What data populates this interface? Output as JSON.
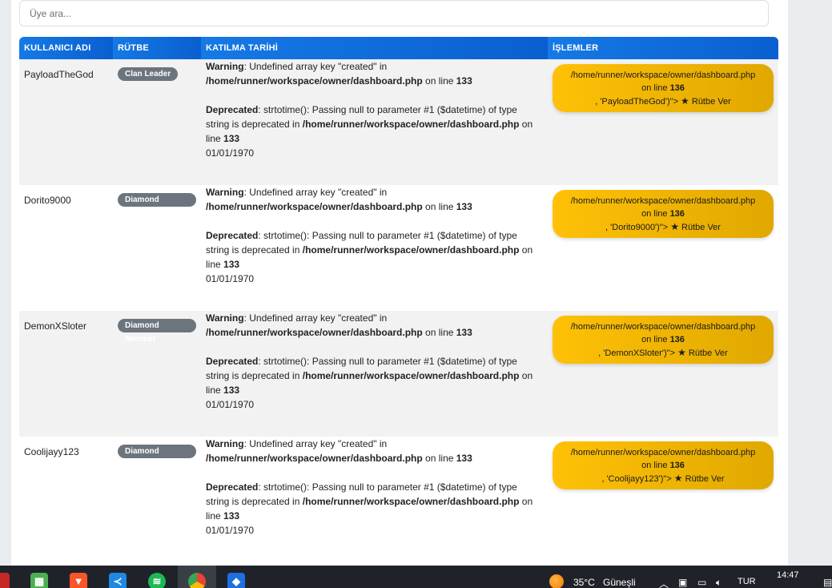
{
  "search": {
    "placeholder": "Üye ara..."
  },
  "table": {
    "headers": [
      "KULLANICI ADI",
      "RÜTBE",
      "KATILMA TARİHİ",
      "İŞLEMLER"
    ],
    "rows": [
      {
        "username": "PayloadTheGod",
        "rank": "Clan Leader",
        "warning": {
          "label": "Warning",
          "text": ": Undefined array key \"created\" in ",
          "path": "/home/runner/workspace/owner/dashboard.php",
          "online": " on line ",
          "line": "133"
        },
        "deprecated": {
          "label": "Deprecated",
          "text": ": strtotime(): Passing null to parameter #1 ($datetime) of type string is deprecated in ",
          "path": "/home/runner/workspace/owner/dashboard.php",
          "online": " on line ",
          "line": "133"
        },
        "date": "01/01/1970",
        "action": {
          "path": "/home/runner/workspace/owner/dashboard.php",
          "online": "on line ",
          "line": "136",
          "tail": ", 'PayloadTheGod')\"> ",
          "label": "Rütbe Ver"
        }
      },
      {
        "username": "Dorito9000",
        "rank": "Diamond Member",
        "warning": {
          "label": "Warning",
          "text": ": Undefined array key \"created\" in ",
          "path": "/home/runner/workspace/owner/dashboard.php",
          "online": " on line ",
          "line": "133"
        },
        "deprecated": {
          "label": "Deprecated",
          "text": ": strtotime(): Passing null to parameter #1 ($datetime) of type string is deprecated in ",
          "path": "/home/runner/workspace/owner/dashboard.php",
          "online": " on line ",
          "line": "133"
        },
        "date": "01/01/1970",
        "action": {
          "path": "/home/runner/workspace/owner/dashboard.php",
          "online": "on line ",
          "line": "136",
          "tail": ", 'Dorito9000')\"> ",
          "label": "Rütbe Ver"
        }
      },
      {
        "username": "DemonXSloter",
        "rank": "Diamond Member",
        "warning": {
          "label": "Warning",
          "text": ": Undefined array key \"created\" in ",
          "path": "/home/runner/workspace/owner/dashboard.php",
          "online": " on line ",
          "line": "133"
        },
        "deprecated": {
          "label": "Deprecated",
          "text": ": strtotime(): Passing null to parameter #1 ($datetime) of type string is deprecated in ",
          "path": "/home/runner/workspace/owner/dashboard.php",
          "online": " on line ",
          "line": "133"
        },
        "date": "01/01/1970",
        "action": {
          "path": "/home/runner/workspace/owner/dashboard.php",
          "online": "on line ",
          "line": "136",
          "tail": ", 'DemonXSloter')\"> ",
          "label": "Rütbe Ver"
        }
      },
      {
        "username": "Coolijayy123",
        "rank": "Diamond Member",
        "warning": {
          "label": "Warning",
          "text": ": Undefined array key \"created\" in ",
          "path": "/home/runner/workspace/owner/dashboard.php",
          "online": " on line ",
          "line": "133"
        },
        "deprecated": {
          "label": "Deprecated",
          "text": ": strtotime(): Passing null to parameter #1 ($datetime) of type string is deprecated in ",
          "path": "/home/runner/workspace/owner/dashboard.php",
          "online": " on line ",
          "line": "133"
        },
        "date": "01/01/1970",
        "action": {
          "path": "/home/runner/workspace/owner/dashboard.php",
          "online": "on line ",
          "line": "136",
          "tail": ", 'Coolijayy123')\"> ",
          "label": "Rütbe Ver"
        }
      }
    ]
  },
  "taskbar": {
    "apps": [
      "minecraft-icon",
      "brave-icon",
      "vscode-icon",
      "spotify-icon",
      "chrome-icon",
      "roblox-icon"
    ],
    "weather_temp": "35°C",
    "weather_text": "Güneşli",
    "lang": "TUR",
    "time": "14:47"
  },
  "colors": {
    "header": "#0a64d6",
    "badge": "#6c757d",
    "button": "#ffc107"
  }
}
